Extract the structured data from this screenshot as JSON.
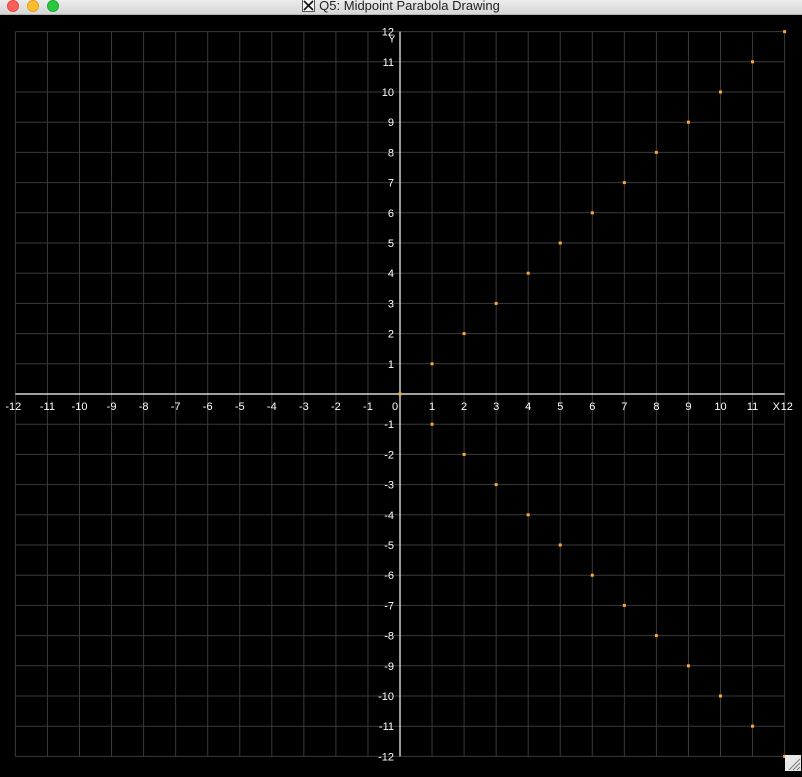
{
  "window": {
    "title": "Q5: Midpoint Parabola Drawing",
    "title_icon": "x11-icon"
  },
  "colors": {
    "background": "#000000",
    "grid": "#3a3a3a",
    "axis": "#ffffff",
    "label": "#ffffff",
    "point": "#ffa634"
  },
  "plot": {
    "x_axis_label": "X",
    "y_axis_label": "Y",
    "xlim": [
      -12,
      12
    ],
    "ylim": [
      -12,
      12
    ],
    "x_tick_labels": [
      "-12",
      "-11",
      "-10",
      "-9",
      "-8",
      "-7",
      "-6",
      "-5",
      "-4",
      "-3",
      "-2",
      "-1",
      "0",
      "1",
      "2",
      "3",
      "4",
      "5",
      "6",
      "7",
      "8",
      "9",
      "10",
      "11",
      "12"
    ],
    "y_tick_labels": [
      "12",
      "11",
      "10",
      "9",
      "8",
      "7",
      "6",
      "5",
      "4",
      "3",
      "2",
      "1",
      "-1",
      "-2",
      "-3",
      "-4",
      "-5",
      "-6",
      "-7",
      "-8",
      "-9",
      "-10",
      "-11",
      "-12"
    ]
  },
  "chart_data": {
    "type": "scatter",
    "title": "",
    "xlabel": "X",
    "ylabel": "Y",
    "xlim": [
      -12,
      12
    ],
    "ylim": [
      -12,
      12
    ],
    "grid": true,
    "series": [
      {
        "points": [
          [
            0,
            0
          ],
          [
            1,
            1
          ],
          [
            2,
            2
          ],
          [
            3,
            3
          ],
          [
            4,
            4
          ],
          [
            5,
            5
          ],
          [
            6,
            6
          ],
          [
            7,
            7
          ],
          [
            8,
            8
          ],
          [
            9,
            9
          ],
          [
            10,
            10
          ],
          [
            11,
            11
          ],
          [
            12,
            12
          ],
          [
            1,
            -1
          ],
          [
            2,
            -2
          ],
          [
            3,
            -3
          ],
          [
            4,
            -4
          ],
          [
            5,
            -5
          ],
          [
            6,
            -6
          ],
          [
            7,
            -7
          ],
          [
            8,
            -8
          ],
          [
            9,
            -9
          ],
          [
            10,
            -10
          ],
          [
            11,
            -11
          ],
          [
            12,
            -12
          ]
        ]
      }
    ]
  }
}
